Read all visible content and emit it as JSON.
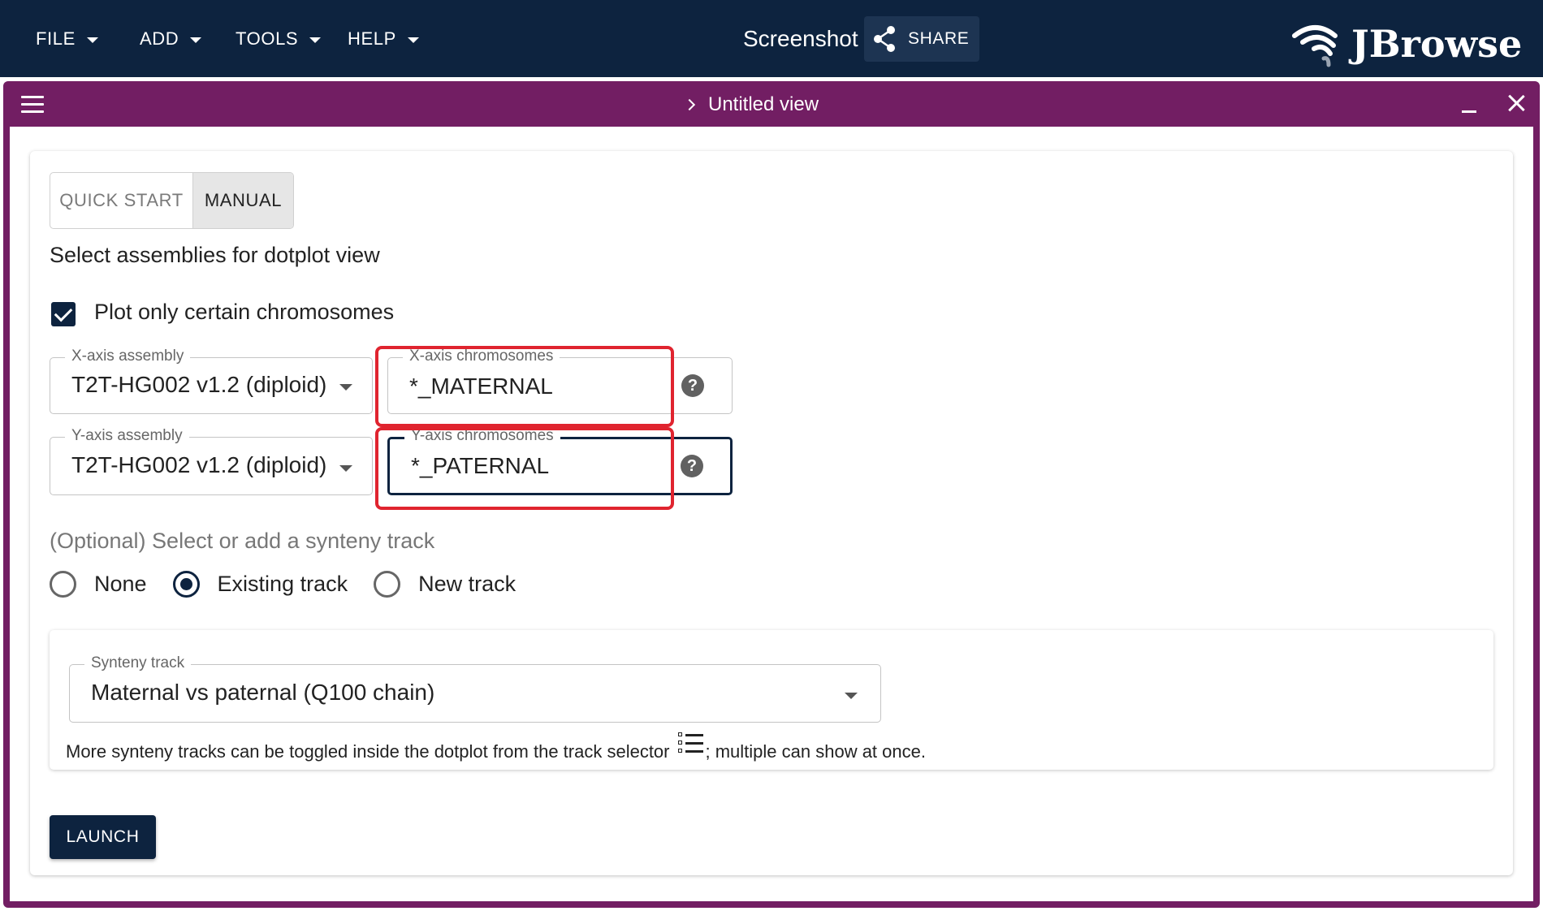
{
  "appbar": {
    "menus": [
      {
        "label": "FILE"
      },
      {
        "label": "ADD"
      },
      {
        "label": "TOOLS"
      },
      {
        "label": "HELP"
      }
    ],
    "title": "Screenshot",
    "share_label": "SHARE",
    "logo_text": "JBrowse"
  },
  "view": {
    "title": "Untitled view",
    "tabs": [
      {
        "label": "QUICK START",
        "selected": false
      },
      {
        "label": "MANUAL",
        "selected": true
      }
    ],
    "heading": "Select assemblies for dotplot view",
    "plot_only_checkbox": {
      "label": "Plot only certain chromosomes",
      "checked": true
    },
    "x_assembly": {
      "label": "X-axis assembly",
      "value": "T2T-HG002 v1.2 (diploid)"
    },
    "x_chromosomes": {
      "label": "X-axis chromosomes",
      "value": "*_MATERNAL"
    },
    "y_assembly": {
      "label": "Y-axis assembly",
      "value": "T2T-HG002 v1.2 (diploid)"
    },
    "y_chromosomes": {
      "label": "Y-axis chromosomes",
      "value": "*_PATERNAL"
    },
    "help_glyph": "?",
    "synteny_heading": "(Optional) Select or add a synteny track",
    "synteny_options": [
      {
        "label": "None",
        "selected": false
      },
      {
        "label": "Existing track",
        "selected": true
      },
      {
        "label": "New track",
        "selected": false
      }
    ],
    "synteny_track": {
      "label": "Synteny track",
      "value": "Maternal vs paternal (Q100 chain)"
    },
    "note_before": "More synteny tracks can be toggled inside the dotplot from the track selector",
    "note_after": "; multiple can show at once.",
    "launch_label": "LAUNCH"
  },
  "colors": {
    "appbar": "#0d233f",
    "view_frame": "#721e63",
    "annotation": "#e0242f",
    "primary": "#0d233f"
  }
}
